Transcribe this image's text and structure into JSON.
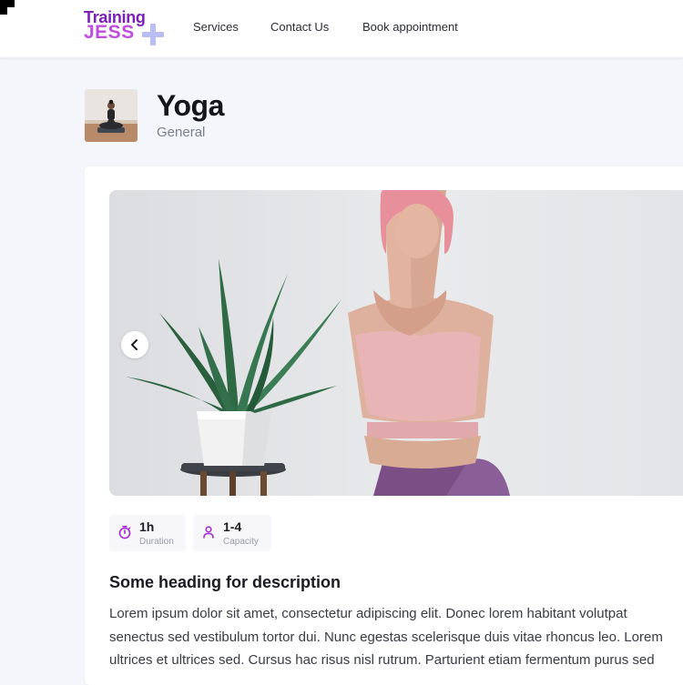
{
  "brand": {
    "line1": "Training",
    "line2": "JESS",
    "colors": {
      "primary": "#7b1fb8",
      "secondary": "#c04ddb",
      "plus": "#b9bdf3"
    }
  },
  "nav": {
    "items": [
      {
        "label": "Services"
      },
      {
        "label": "Contact Us"
      },
      {
        "label": "Book appointment"
      }
    ]
  },
  "class": {
    "title": "Yoga",
    "category": "General"
  },
  "carousel": {
    "prev_icon": "chevron-left-icon"
  },
  "stats": [
    {
      "icon": "stopwatch-icon",
      "value": "1h",
      "label": "Duration"
    },
    {
      "icon": "person-icon",
      "value": "1-4",
      "label": "Capacity"
    }
  ],
  "description": {
    "heading": "Some heading for description",
    "lines": [
      "Lorem ipsum dolor sit amet, consectetur adipiscing elit. Donec lorem habitant volutpat",
      "senectus sed vestibulum tortor dui. Nunc egestas scelerisque duis vitae rhoncus leo. Lorem",
      "ultrices et ultrices sed. Cursus hac risus nisl rutrum. Parturient etiam fermentum purus sed"
    ]
  }
}
